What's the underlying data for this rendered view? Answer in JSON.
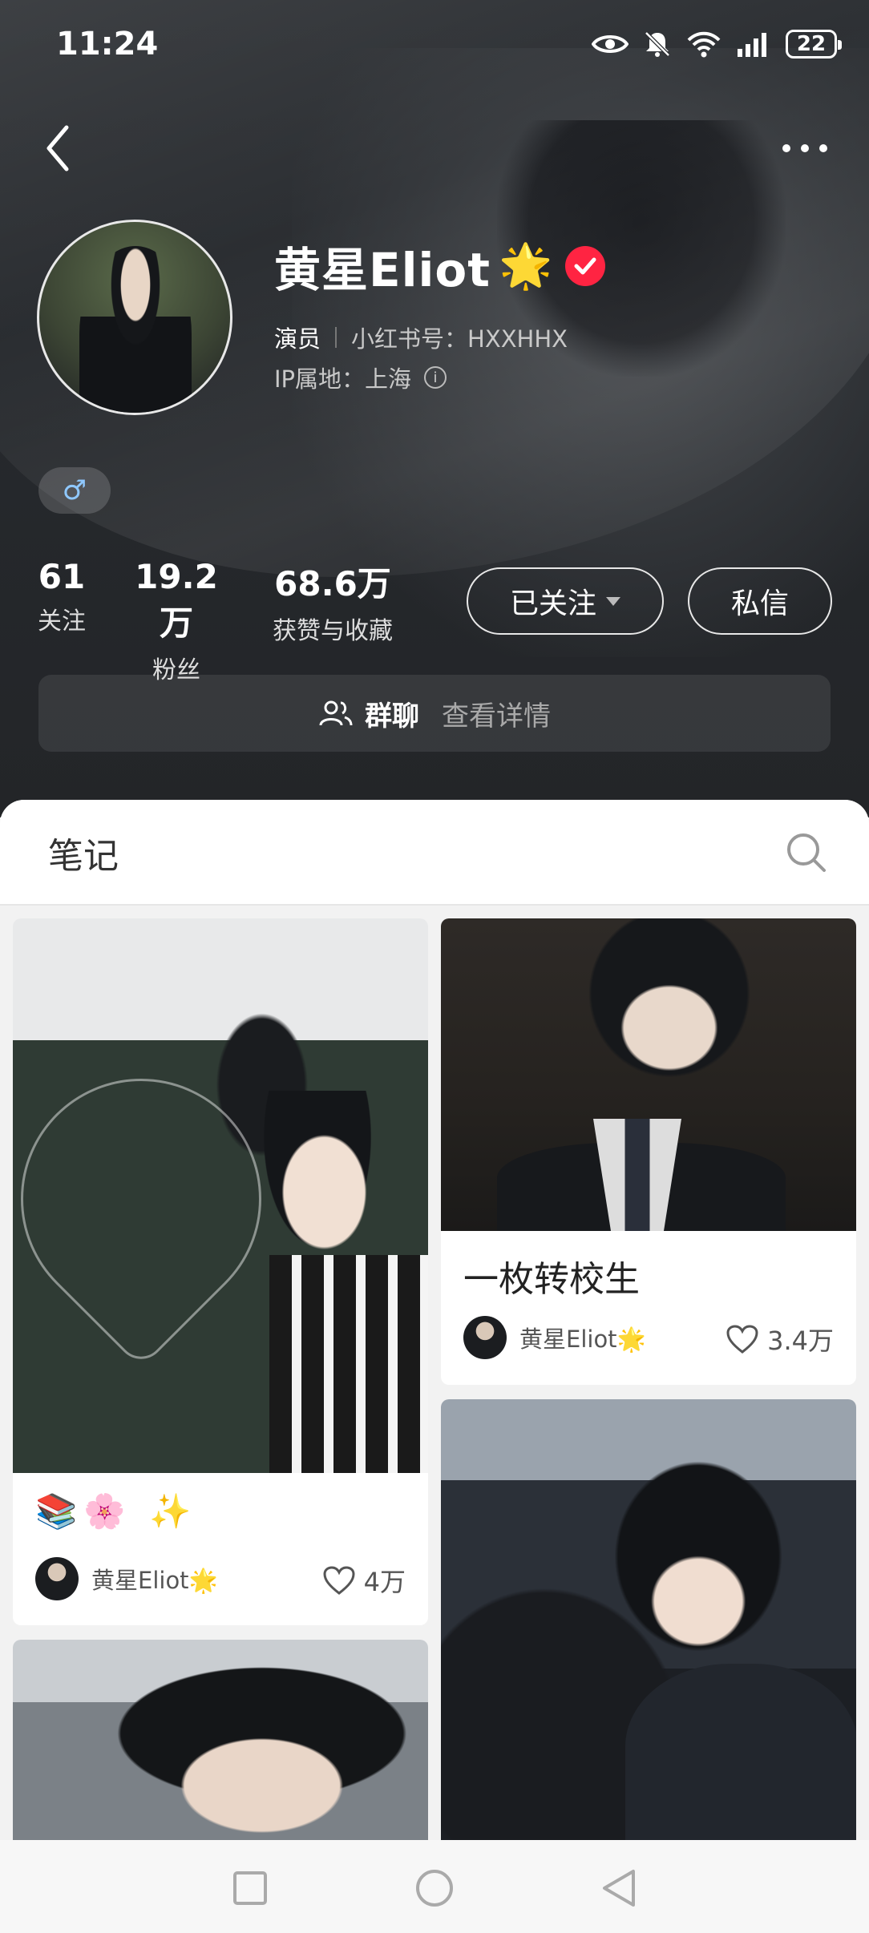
{
  "status_bar": {
    "time": "11:24",
    "battery": "22",
    "icons": [
      "eye-icon",
      "bell-muted-icon",
      "wifi-icon",
      "signal-icon",
      "battery-icon"
    ]
  },
  "profile": {
    "name": "黄星Eliot",
    "name_emoji": "🌟",
    "role": "演员",
    "red_id": "小红书号：HXXHHX",
    "ip_location": "IP属地：上海",
    "gender_symbol": "♂",
    "accent_color": "#ff2442"
  },
  "stats": {
    "following": {
      "value": "61",
      "label": "关注"
    },
    "fans": {
      "value": "19.2万",
      "label": "粉丝"
    },
    "likes": {
      "value": "68.6万",
      "label": "获赞与收藏"
    }
  },
  "actions": {
    "follow_label": "已关注",
    "message_label": "私信"
  },
  "group_chat": {
    "title": "群聊",
    "detail": "查看详情"
  },
  "tabs": {
    "notes": "笔记"
  },
  "notes": [
    {
      "title": "📚🌸 ✨",
      "author": "黄星Eliot🌟",
      "likes": "4万"
    },
    {
      "title": "一枚转校生",
      "author": "黄星Eliot🌟",
      "likes": "3.4万"
    }
  ]
}
